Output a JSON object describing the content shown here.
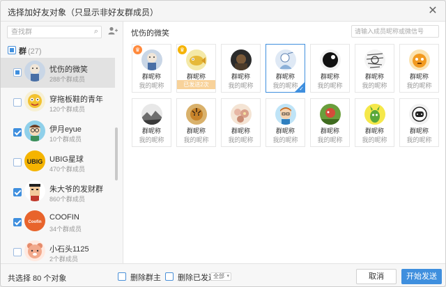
{
  "window": {
    "title": "选择加好友对象（只显示非好友群成员）"
  },
  "sidebar": {
    "search_placeholder": "查找群",
    "group_header": {
      "label": "群",
      "count": "(27)"
    },
    "items": [
      {
        "name": "忧伤的微笑",
        "count": "288个群成员",
        "checked": "partial",
        "active": true,
        "avatar": "cartoon-blue"
      },
      {
        "name": "穿拖板鞋的青年",
        "count": "120个群成员",
        "checked": "none",
        "active": false,
        "avatar": "cartoon-yellow"
      },
      {
        "name": "伊月eyue",
        "count": "10个群成员",
        "checked": "checked",
        "active": false,
        "avatar": "cartoon-glasses"
      },
      {
        "name": "UBIG星球",
        "count": "470个群成员",
        "checked": "none",
        "active": false,
        "avatar": "ubig-logo"
      },
      {
        "name": "朱大爷的发财群",
        "count": "860个群成员",
        "checked": "checked",
        "active": false,
        "avatar": "pixel-face"
      },
      {
        "name": "COOFIN",
        "count": "34个群成员",
        "checked": "checked",
        "active": false,
        "avatar": "coofin-logo"
      },
      {
        "name": "小石头1125",
        "count": "2个群成员",
        "checked": "none",
        "active": false,
        "avatar": "cartoon-bear"
      }
    ]
  },
  "main": {
    "title": "忧伤的微笑",
    "search_placeholder": "请输入成员昵称或微信号",
    "members": [
      {
        "group_name": "群昵称",
        "nickname": "我的昵称",
        "badge": "crown",
        "avatar": "cartoon-blue"
      },
      {
        "group_name": "群昵称",
        "nickname": "我的昵称",
        "badge": "crown-gold",
        "sent_label": "已发送2次",
        "avatar": "cartoon-fish"
      },
      {
        "group_name": "群昵称",
        "nickname": "我的昵称",
        "avatar": "dark-photo"
      },
      {
        "group_name": "群昵称",
        "nickname": "我的昵称",
        "selected": true,
        "avatar": "sketch-blue"
      },
      {
        "group_name": "群昵称",
        "nickname": "我的昵称",
        "avatar": "black-white"
      },
      {
        "group_name": "群昵称",
        "nickname": "我的昵称",
        "avatar": "sketch-lines"
      },
      {
        "group_name": "群昵称",
        "nickname": "我的昵称",
        "avatar": "orange-toy"
      },
      {
        "group_name": "群昵称",
        "nickname": "我的昵称",
        "avatar": "misty-landscape"
      },
      {
        "group_name": "群昵称",
        "nickname": "我的昵称",
        "avatar": "tiger-painting"
      },
      {
        "group_name": "群昵称",
        "nickname": "我的昵称",
        "avatar": "flowers"
      },
      {
        "group_name": "群昵称",
        "nickname": "我的昵称",
        "avatar": "cartoon-boy"
      },
      {
        "group_name": "群昵称",
        "nickname": "我的昵称",
        "avatar": "red-green"
      },
      {
        "group_name": "群昵称",
        "nickname": "我的昵称",
        "avatar": "green-creature"
      },
      {
        "group_name": "群昵称",
        "nickname": "我的昵称",
        "avatar": "astronaut"
      }
    ]
  },
  "footer": {
    "total": "共选择 80 个对象",
    "remove_owner": "删除群主",
    "remove_sent": "删除已发送",
    "filter_value": "全部",
    "cancel": "取消",
    "send": "开始发送"
  },
  "colors": {
    "accent": "#3f8fde",
    "sent_badge": "#f8d29a",
    "crown": "#ff8a3d",
    "crown_gold": "#f5b300"
  }
}
